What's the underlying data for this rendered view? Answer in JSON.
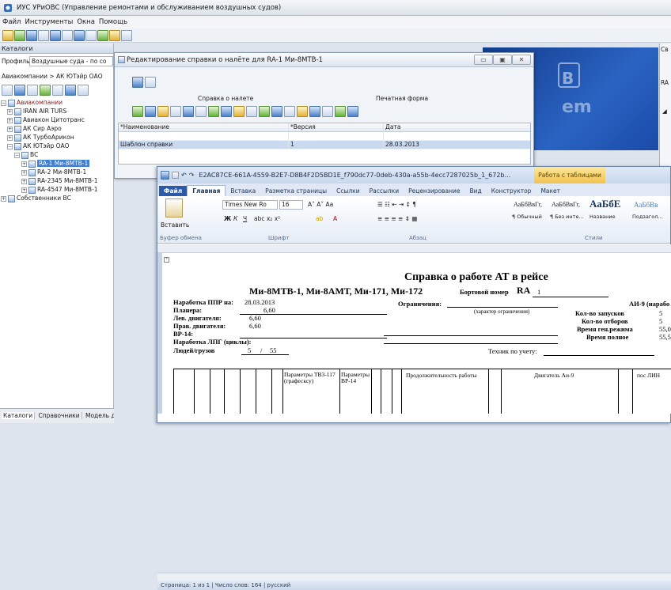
{
  "app": {
    "title": "ИУС УРиОВС (Управление ремонтами и обслуживанием воздушных судов)",
    "menu": [
      "Файл",
      "Инструменты",
      "Окна",
      "Помощь"
    ]
  },
  "left_panel": {
    "title": "Каталоги",
    "profile_label": "Профиль:",
    "profile_value": "Воздушные суда - по со",
    "breadcrumb": [
      "Авиакомпании",
      ">",
      "АК ЮТэйр ОАО"
    ],
    "tree": [
      "Авиакомпании",
      "IRAN AIR TURS",
      "Авиакон Цитотранс",
      "АК Сир Аэро",
      "АК ТурбоАрикон",
      "АК ЮТэйр ОАО",
      "ВС",
      "RA-1 Ми-8МТВ-1",
      "RA-2 Ми-8МТВ-1",
      "RA-2345 Ми-8МТВ-1",
      "RA-4547 Ми-8МТВ-1",
      "Собственники ВС"
    ],
    "bottom_tabs": [
      "Каталоги",
      "Справочники",
      "Модель да"
    ]
  },
  "right_panel": {
    "title": "Св",
    "items": [
      "RA"
    ]
  },
  "dialog": {
    "title": "Редактирование справки о налёте для RA-1 Ми-8МТВ-1",
    "section_left": "Справка о налете",
    "section_right": "Печатная форма",
    "columns": [
      "*Наименование",
      "*Версия",
      "Дата"
    ],
    "rows": [
      [
        "",
        "",
        ""
      ],
      [
        "Шаблон справки",
        "1",
        "28.03.2013"
      ]
    ],
    "win_buttons": [
      "▭",
      "▣",
      "✕"
    ]
  },
  "word": {
    "doc_title": "E2AC87CE-661A-4559-B2E7-D8B4F2D5BD1E_f790dc77-0deb-430a-a55b-4ecc7287025b_1_672b...",
    "context_tab": "Работа с таблицами",
    "tabs": [
      "Файл",
      "Главная",
      "Вставка",
      "Разметка страницы",
      "Ссылки",
      "Рассылки",
      "Рецензирование",
      "Вид",
      "Конструктор",
      "Макет"
    ],
    "font_name": "Times New Ro",
    "font_size": "16",
    "paste_label": "Вставить",
    "groups": [
      "Буфер обмена",
      "Шрифт",
      "Абзац",
      "Стили"
    ],
    "styles": [
      {
        "sample": "АаБбВвГг,",
        "name": "¶ Обычный"
      },
      {
        "sample": "АаБбВвГг,",
        "name": "¶ Без инте..."
      },
      {
        "sample": "АаБбЕ",
        "name": "Название"
      },
      {
        "sample": "АаБбВв",
        "name": "Подзагол..."
      }
    ],
    "status": "Страница: 1 из 1   |   Число слов: 164   |   русский"
  },
  "doc": {
    "heading": "Справка о работе АТ в рейсе",
    "aircraft": "Ми-8МТВ-1, Ми-8АМТ, Ми-171, Ми-172",
    "board_label": "Бортовой номер",
    "board_value": "RA",
    "board_num": "1",
    "ppr_label": "Наработка ППР на:",
    "ppr_date": "28.03.2013",
    "glider_label": "Планера:",
    "glider_val": "6,60",
    "left_eng_label": "Лев. двигателя:",
    "left_eng_val": "6,60",
    "right_eng_label": "Прав. двигателя:",
    "right_eng_val": "6,60",
    "vr_label": "ВР-14:",
    "lpg_label": "Наработка ЛПГ (циклы):",
    "people_label": "Людей/грузов",
    "people_val": "5",
    "cargo_val": "55",
    "limits_label": "Ограничения:",
    "limits_hint": "(характер ограничения)",
    "ai9": "АИ-9 (нарабо",
    "starts_label": "Кол-во запусков",
    "starts_val": "5",
    "bleeds_label": "Кол-во отборов",
    "bleeds_val": "5",
    "gen_label": "Время ген.режима",
    "gen_val": "55,0",
    "full_label": "Время полное",
    "full_val": "55,5",
    "tech_label": "Техник по учету:",
    "table_headers": [
      "Параметры ТВ3-117 (графесксу)",
      "Параметры ВР-14",
      "Продолжительность работы",
      "Двигатель Аи-9",
      "пос ЛИН"
    ]
  }
}
